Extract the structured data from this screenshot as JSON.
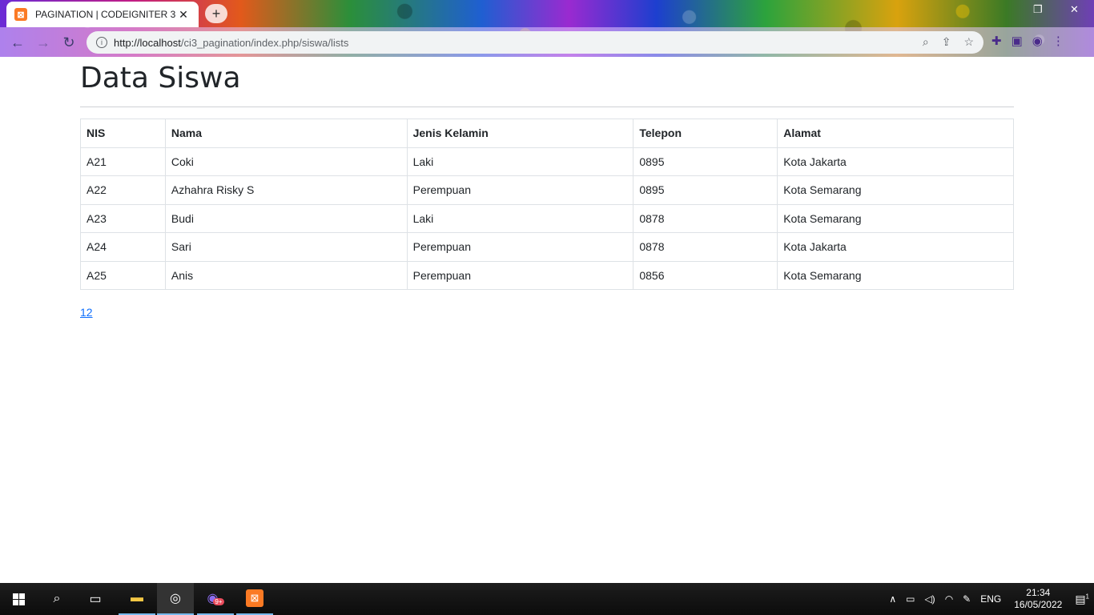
{
  "browser": {
    "tab_title": "PAGINATION | CODEIGNITER 3",
    "url_host": "http://localhost",
    "url_path": "/ci3_pagination/index.php/siswa/lists"
  },
  "page": {
    "title": "Data Siswa",
    "table": {
      "headers": [
        "NIS",
        "Nama",
        "Jenis Kelamin",
        "Telepon",
        "Alamat"
      ],
      "rows": [
        [
          "A21",
          "Coki",
          "Laki",
          "0895",
          "Kota Jakarta"
        ],
        [
          "A22",
          "Azhahra Risky S",
          "Perempuan",
          "0895",
          "Kota Semarang"
        ],
        [
          "A23",
          "Budi",
          "Laki",
          "0878",
          "Kota Semarang"
        ],
        [
          "A24",
          "Sari",
          "Perempuan",
          "0878",
          "Kota Jakarta"
        ],
        [
          "A25",
          "Anis",
          "Perempuan",
          "0856",
          "Kota Semarang"
        ]
      ]
    },
    "pagination": {
      "label": "12"
    }
  },
  "taskbar": {
    "language": "ENG",
    "time": "21:34",
    "date": "16/05/2022",
    "notification_count": "1",
    "messenger_badge": "9+"
  },
  "colors": {
    "link": "#0d6efd",
    "text": "#212529",
    "border": "#dee2e6"
  }
}
